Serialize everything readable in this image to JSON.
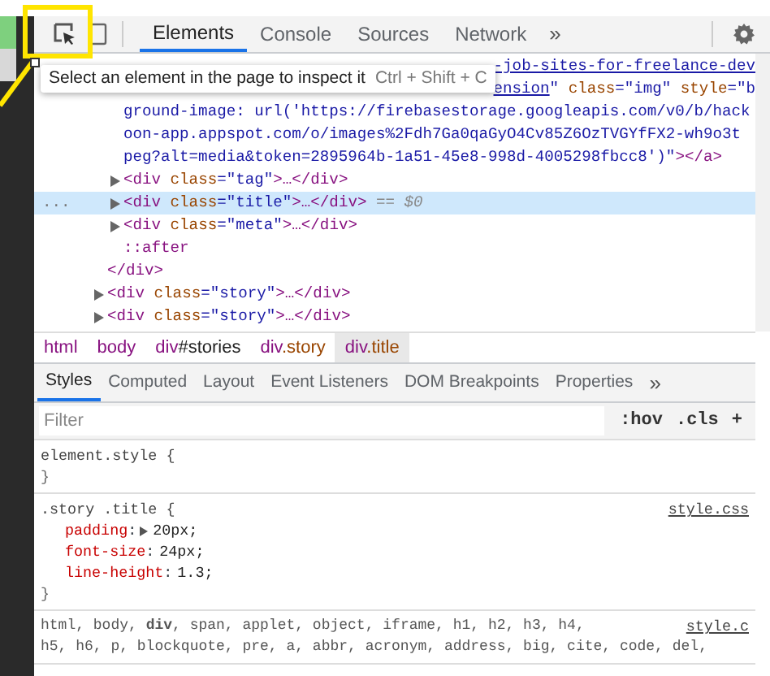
{
  "toolbar": {
    "tabs": [
      {
        "label": "Elements",
        "selected": true
      },
      {
        "label": "Console",
        "selected": false
      },
      {
        "label": "Sources",
        "selected": false
      },
      {
        "label": "Network",
        "selected": false
      }
    ],
    "more": "»"
  },
  "tooltip": {
    "text": "Select an element in the page to inspect it",
    "shortcut": "Ctrl + Shift + C"
  },
  "tree": [
    {
      "kind": "container",
      "children": [
        {
          "kind": "wrapped",
          "lines": [
            [
              {
                "text": "-job-sites-for-freelance-dev",
                "kind": "link"
              }
            ],
            [
              {
                "text": "ension",
                "kind": "link"
              },
              {
                "text": "\" ",
                "kind": "value"
              },
              {
                "text": "class",
                "kind": "attr"
              },
              {
                "text": "=\"img\" ",
                "kind": "value"
              },
              {
                "text": "style",
                "kind": "attr"
              },
              {
                "text": "=\"b",
                "kind": "value"
              }
            ],
            [
              {
                "text": "ground-image: url('https://firebasestorage.googleapis.com/v0/b/hack",
                "kind": "value"
              }
            ],
            [
              {
                "text": "oon-app.appspot.com/o/images%2Fdh7Ga0qaGyO4Cv85Z6OzTVGYfFX2-wh9o3t",
                "kind": "value"
              }
            ],
            [
              {
                "text": "peg?alt=media&token=2895964b-1a51-45e8-998d-4005298fbcc8')\"",
                "kind": "value"
              },
              {
                "text": "></a>",
                "kind": "tag"
              }
            ]
          ]
        },
        {
          "kind": "node",
          "expanded": false,
          "selected": false,
          "segments": [
            {
              "text": "<div ",
              "kind": "tag"
            },
            {
              "text": "class",
              "kind": "attr"
            },
            {
              "text": "=\"tag\"",
              "kind": "value"
            },
            {
              "text": ">…</div>",
              "kind": "tag"
            }
          ]
        },
        {
          "kind": "node",
          "expanded": false,
          "selected": true,
          "gutter": "...",
          "segments": [
            {
              "text": "<div ",
              "kind": "tag"
            },
            {
              "text": "class",
              "kind": "attr"
            },
            {
              "text": "=\"title\"",
              "kind": "value"
            },
            {
              "text": ">…</div>",
              "kind": "tag"
            },
            {
              "text": " == $0",
              "kind": "dim"
            }
          ]
        },
        {
          "kind": "node",
          "expanded": false,
          "selected": false,
          "segments": [
            {
              "text": "<div ",
              "kind": "tag"
            },
            {
              "text": "class",
              "kind": "attr"
            },
            {
              "text": "=\"meta\"",
              "kind": "value"
            },
            {
              "text": ">…</div>",
              "kind": "tag"
            }
          ]
        },
        {
          "kind": "pseudo",
          "segments": [
            {
              "text": "::after",
              "kind": "tag"
            }
          ]
        }
      ],
      "closing": [
        {
          "text": "</div>",
          "kind": "tag"
        }
      ]
    },
    {
      "kind": "node",
      "expanded": false,
      "selected": false,
      "segments": [
        {
          "text": "<div ",
          "kind": "tag"
        },
        {
          "text": "class",
          "kind": "attr"
        },
        {
          "text": "=\"story\"",
          "kind": "value"
        },
        {
          "text": ">…</div>",
          "kind": "tag"
        }
      ]
    },
    {
      "kind": "node",
      "expanded": false,
      "selected": false,
      "segments": [
        {
          "text": "<div ",
          "kind": "tag"
        },
        {
          "text": "class",
          "kind": "attr"
        },
        {
          "text": "=\"story\"",
          "kind": "value"
        },
        {
          "text": ">…</div>",
          "kind": "tag"
        }
      ]
    }
  ],
  "breadcrumbs": [
    {
      "tag": "html",
      "selected": false
    },
    {
      "tag": "body",
      "selected": false
    },
    {
      "tag": "div",
      "rest": "#stories",
      "kind": "id",
      "selected": false
    },
    {
      "tag": "div",
      "rest": ".story",
      "kind": "class",
      "selected": false
    },
    {
      "tag": "div",
      "rest": ".title",
      "kind": "class",
      "selected": true
    }
  ],
  "subtabs": [
    {
      "label": "Styles",
      "selected": true
    },
    {
      "label": "Computed",
      "selected": false
    },
    {
      "label": "Layout",
      "selected": false
    },
    {
      "label": "Event Listeners",
      "selected": false
    },
    {
      "label": "DOM Breakpoints",
      "selected": false
    },
    {
      "label": "Properties",
      "selected": false
    }
  ],
  "subtabs_more": "»",
  "filter": {
    "placeholder": "Filter",
    "buttons": [
      ":hov",
      ".cls",
      "+"
    ]
  },
  "rules": [
    {
      "selector": "element.style {",
      "close": "}"
    },
    {
      "selector": ".story .title {",
      "source": "style.css",
      "close": "}",
      "declarations": [
        {
          "name": "padding",
          "separator": ":",
          "value": "20px;",
          "expandable": true
        },
        {
          "name": "font-size",
          "separator": ":",
          "value": "24px;",
          "expandable": false
        },
        {
          "name": "line-height",
          "separator": ":",
          "value": "1.3;",
          "expandable": false
        }
      ]
    },
    {
      "selector_lines": [
        "html, body, **div**, span, applet, object, iframe, h1, h2, h3, h4,",
        "h5, h6, p, blockquote, pre, a, abbr, acronym, address, big, cite, code, del,"
      ],
      "source": "style.c"
    }
  ]
}
